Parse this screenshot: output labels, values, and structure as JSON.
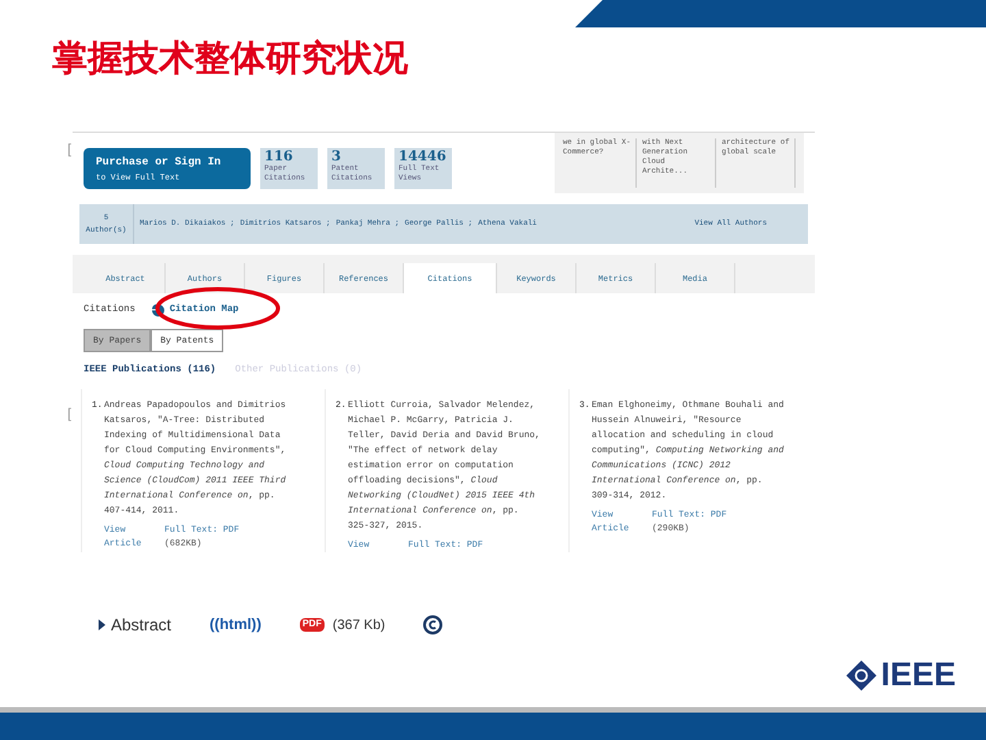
{
  "slide": {
    "title": "掌握技术整体研究状况"
  },
  "page": {
    "brackets": [
      "[",
      "["
    ],
    "purchase": {
      "line1": "Purchase or Sign In",
      "line2": "to View Full Text"
    },
    "stats": [
      {
        "value": "116",
        "label": "Paper Citations"
      },
      {
        "value": "3",
        "label": "Patent Citations"
      },
      {
        "value": "14446",
        "label": "Full Text Views"
      }
    ],
    "related": [
      "we in global X-Commerce?",
      "with Next Generation Cloud Archite...",
      "architecture of global scale"
    ],
    "authors": {
      "count": "5",
      "label": "Author(s)",
      "names": [
        "Marios D. Dikaiakos ;",
        "Dimitrios Katsaros ;",
        "Pankaj Mehra ;",
        "George Pallis ;",
        "Athena Vakali"
      ],
      "view_all": "View All Authors"
    },
    "tabs": [
      {
        "label": "Abstract",
        "selected": false
      },
      {
        "label": "Authors",
        "selected": false
      },
      {
        "label": "Figures",
        "selected": false
      },
      {
        "label": "References",
        "selected": false
      },
      {
        "label": "Citations",
        "selected": true
      },
      {
        "label": "Keywords",
        "selected": false
      },
      {
        "label": "Metrics",
        "selected": false
      },
      {
        "label": "Media",
        "selected": false
      }
    ],
    "citations_label": "Citations",
    "citation_map": "Citation Map",
    "toggle": [
      {
        "label": "By Papers",
        "selected": true
      },
      {
        "label": "By Patents",
        "selected": false
      }
    ],
    "publication_tabs": [
      {
        "label": "IEEE Publications (116)",
        "selected": true
      },
      {
        "label": "Other Publications (0)",
        "selected": false
      }
    ],
    "results": [
      {
        "number": "1.",
        "text": "Andreas Papadopoulos and Dimitrios Katsaros, \"A-Tree: Distributed Indexing of Multidimensional Data for Cloud Computing Environments\", *Cloud Computing Technology and Science (CloudCom) 2011 IEEE Third International Conference on*, pp. 407-414, 2011.",
        "view": "View Article",
        "full_text": "Full Text: PDF",
        "size": "(682KB)"
      },
      {
        "number": "2.",
        "text": "Elliott Curroia, Salvador Melendez, Michael P. McGarry, Patricia J. Teller, David Deria and David Bruno, \"The effect of network delay estimation error on computation offloading decisions\", *Cloud Networking (CloudNet) 2015 IEEE 4th International Conference on*, pp. 325-327, 2015.",
        "view": "View",
        "full_text": "Full Text: PDF"
      },
      {
        "number": "3.",
        "text": "Eman Elghoneimy, Othmane Bouhali and Hussein Alnuweiri, \"Resource allocation and scheduling in cloud computing\", *Computing Networking and Communications (ICNC) 2012 International Conference on*, pp. 309-314, 2012.",
        "view": "View Article",
        "full_text": "Full Text: PDF",
        "size": "(290KB)"
      }
    ]
  },
  "footer": {
    "abstract": "Abstract",
    "html": "((html))",
    "pdf": "PDF",
    "size": "(367 Kb)"
  },
  "logo": "IEEE"
}
